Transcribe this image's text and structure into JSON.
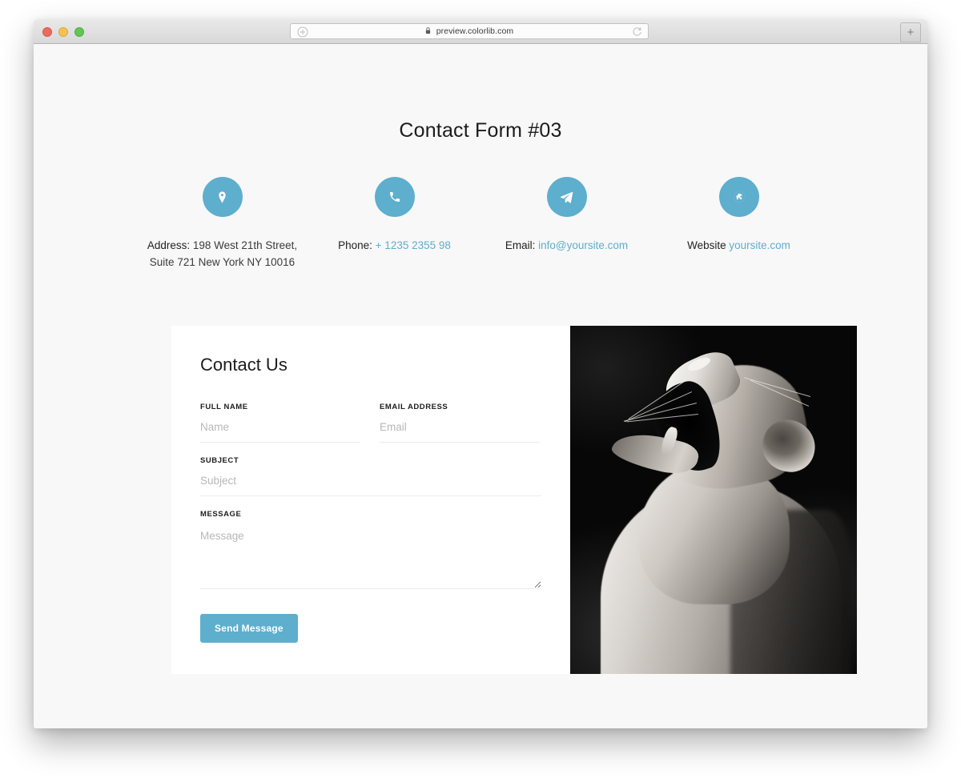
{
  "browser": {
    "url": "preview.colorlib.com",
    "lock_icon": "lock-icon",
    "add_bookmark_icon": "add-circle-icon",
    "reload_icon": "reload-icon",
    "new_tab_label": "+",
    "traffic_lights": [
      "close",
      "minimize",
      "maximize"
    ],
    "accent": "#5eaecd"
  },
  "page": {
    "title": "Contact Form #03",
    "background": "#f8f8f8",
    "contact_items": [
      {
        "icon": "map-pin-icon",
        "label": "Address:",
        "value": "198 West 21th Street,",
        "value_line2": "Suite 721 New York NY 10016",
        "link": false
      },
      {
        "icon": "phone-icon",
        "label": "Phone:",
        "value": "+ 1235 2355 98",
        "value_line2": "",
        "link": true
      },
      {
        "icon": "paper-plane-icon",
        "label": "Email:",
        "value": "info@yoursite.com",
        "value_line2": "",
        "link": true
      },
      {
        "icon": "globe-icon",
        "label": "Website",
        "value": "yoursite.com",
        "value_line2": "",
        "link": true
      }
    ],
    "form": {
      "heading": "Contact Us",
      "fields": {
        "full_name": {
          "label": "FULL NAME",
          "placeholder": "Name",
          "value": ""
        },
        "email": {
          "label": "EMAIL ADDRESS",
          "placeholder": "Email",
          "value": ""
        },
        "subject": {
          "label": "SUBJECT",
          "placeholder": "Subject",
          "value": ""
        },
        "message": {
          "label": "MESSAGE",
          "placeholder": "Message",
          "value": ""
        }
      },
      "submit_label": "Send Message",
      "submit_color": "#5eaecd"
    },
    "photo": {
      "alt": "Black and white photograph of a roaring lioness",
      "treatment": "grayscale"
    }
  }
}
